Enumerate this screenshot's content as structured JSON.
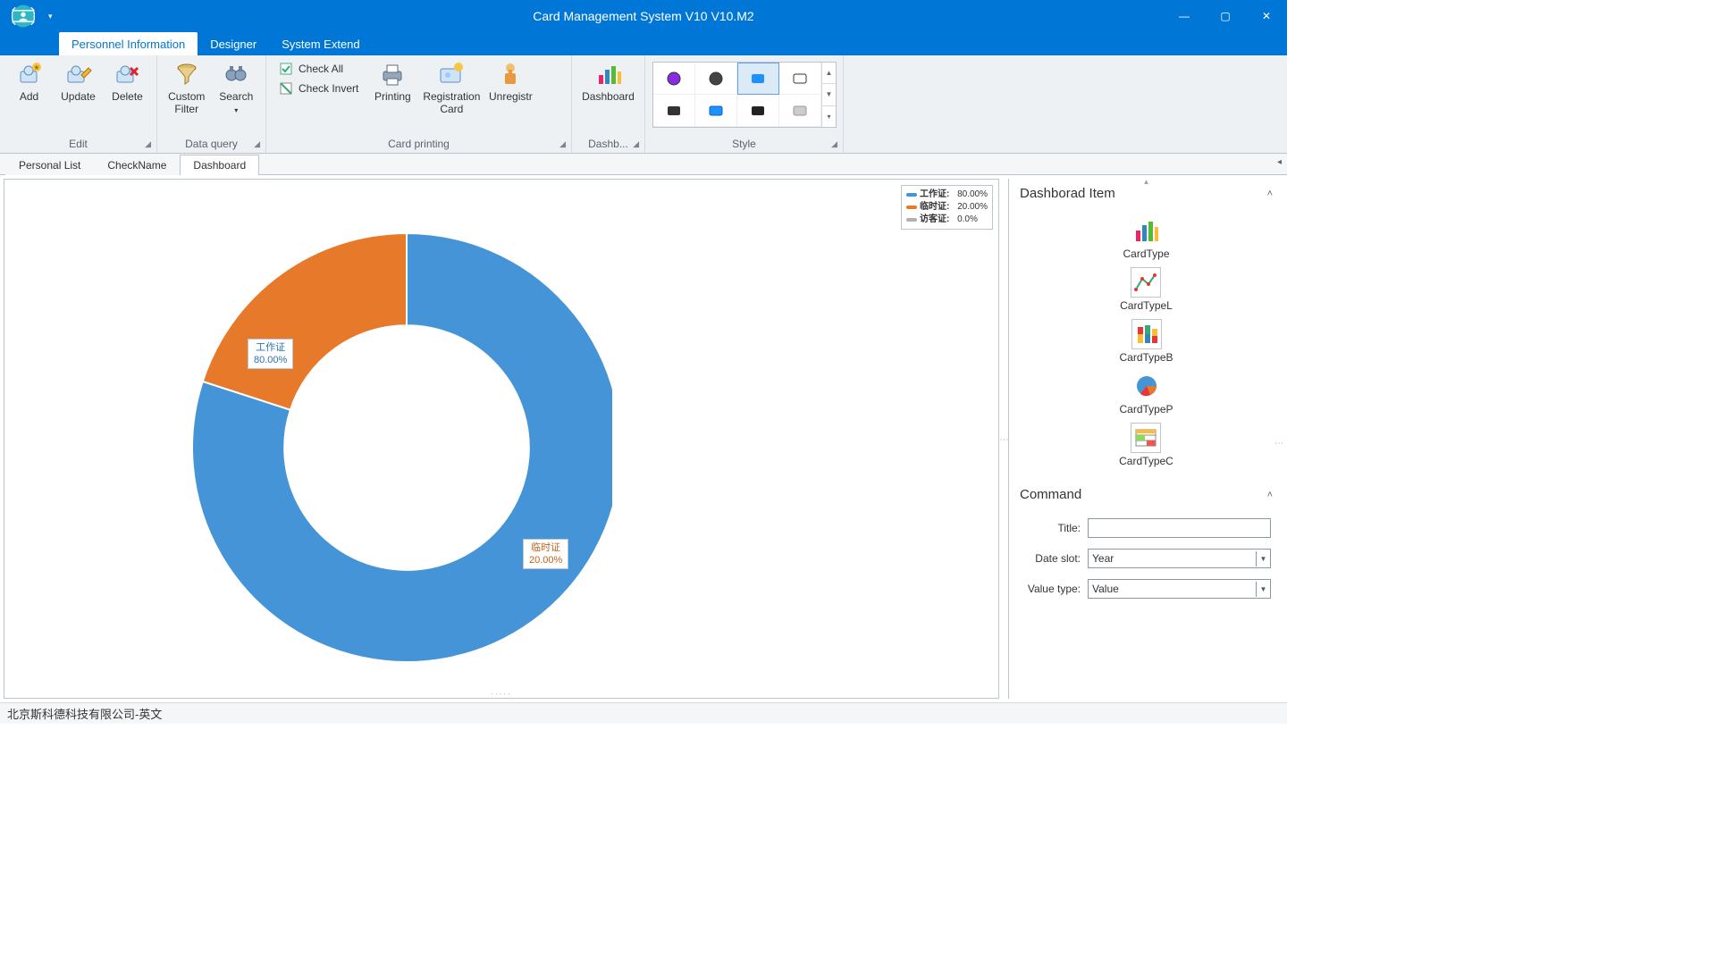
{
  "app": {
    "title": "Card Management System V10 V10.M2"
  },
  "ribbon_tabs": [
    "Personnel Information",
    "Designer",
    "System Extend"
  ],
  "ribbon": {
    "edit": {
      "caption": "Edit",
      "add": "Add",
      "update": "Update",
      "delete": "Delete"
    },
    "dataquery": {
      "caption": "Data query",
      "custom_filter": "Custom\nFilter",
      "search": "Search"
    },
    "cardprinting": {
      "caption": "Card printing",
      "check_all": "Check All",
      "check_invert": "Check Invert",
      "printing": "Printing",
      "registration_card": "Registration\nCard",
      "unregistr": "Unregistr"
    },
    "dashboard": {
      "caption": "Dashb...",
      "dashboard": "Dashboard"
    },
    "style": {
      "caption": "Style"
    }
  },
  "doc_tabs": [
    "Personal List",
    "CheckName",
    "Dashboard"
  ],
  "chart_data": {
    "type": "pie",
    "series": [
      {
        "name": "工作证",
        "value": 80.0,
        "percent_label": "80.00%",
        "color": "#4594d7"
      },
      {
        "name": "临时证",
        "value": 20.0,
        "percent_label": "20.00%",
        "color": "#e77a2a"
      },
      {
        "name": "访客证",
        "value": 0.0,
        "percent_label": "0.0%",
        "color": "#b0b0b0"
      }
    ],
    "legend": [
      {
        "label": "工作证:",
        "value": "80.00%",
        "color": "#4594d7"
      },
      {
        "label": "临时证:",
        "value": "20.00%",
        "color": "#e77a2a"
      },
      {
        "label": "访客证:",
        "value": "0.0%",
        "color": "#b0b0b0"
      }
    ],
    "donut_inner_ratio": 0.57
  },
  "side": {
    "dashboard_item": {
      "header": "Dashborad Item",
      "items": [
        "CardType",
        "CardTypeL",
        "CardTypeB",
        "CardTypeP",
        "CardTypeC"
      ]
    },
    "command": {
      "header": "Command",
      "title_label": "Title:",
      "title_value": "",
      "date_slot_label": "Date slot:",
      "date_slot_value": "Year",
      "value_type_label": "Value type:",
      "value_type_value": "Value"
    }
  },
  "statusbar": {
    "text": "北京斯科德科技有限公司-英文"
  }
}
